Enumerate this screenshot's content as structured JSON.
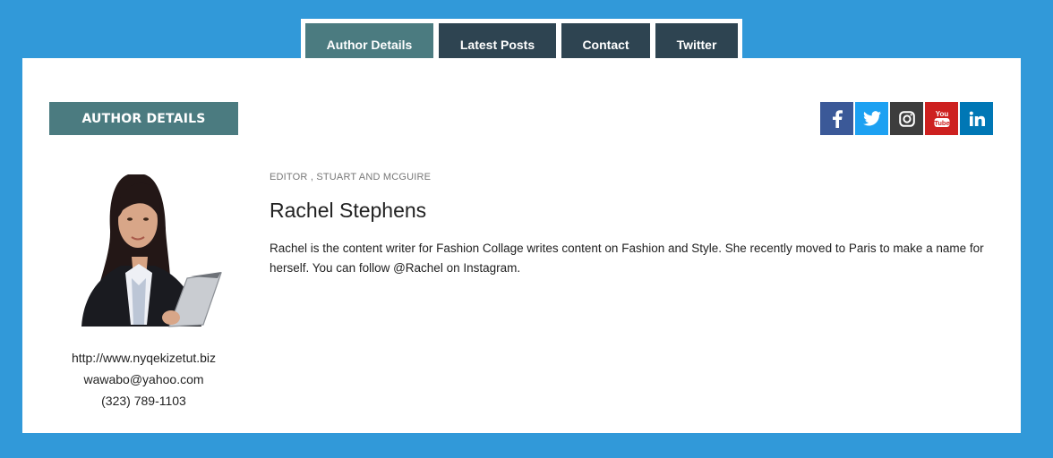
{
  "tabs": [
    {
      "label": "Author Details",
      "active": true
    },
    {
      "label": "Latest Posts",
      "active": false
    },
    {
      "label": "Contact",
      "active": false
    },
    {
      "label": "Twitter",
      "active": false
    }
  ],
  "section": {
    "title": "AUTHOR DETAILS"
  },
  "social": [
    {
      "icon": "facebook-icon",
      "color": "#3b5998"
    },
    {
      "icon": "twitter-icon",
      "color": "#1da1f2"
    },
    {
      "icon": "instagram-icon",
      "color": "#3d3d3d"
    },
    {
      "icon": "youtube-icon",
      "color": "#cd201f"
    },
    {
      "icon": "linkedin-icon",
      "color": "#0077b5"
    }
  ],
  "author": {
    "role": "EDITOR , STUART AND MCGUIRE",
    "name": "Rachel Stephens",
    "bio": "Rachel is the content writer for Fashion Collage writes content on Fashion and Style. She recently moved to Paris to make a name for herself. You can follow @Rachel on Instagram.",
    "website": "http://www.nyqekizetut.biz",
    "email": "wawabo@yahoo.com",
    "phone": "(323) 789-1103"
  }
}
